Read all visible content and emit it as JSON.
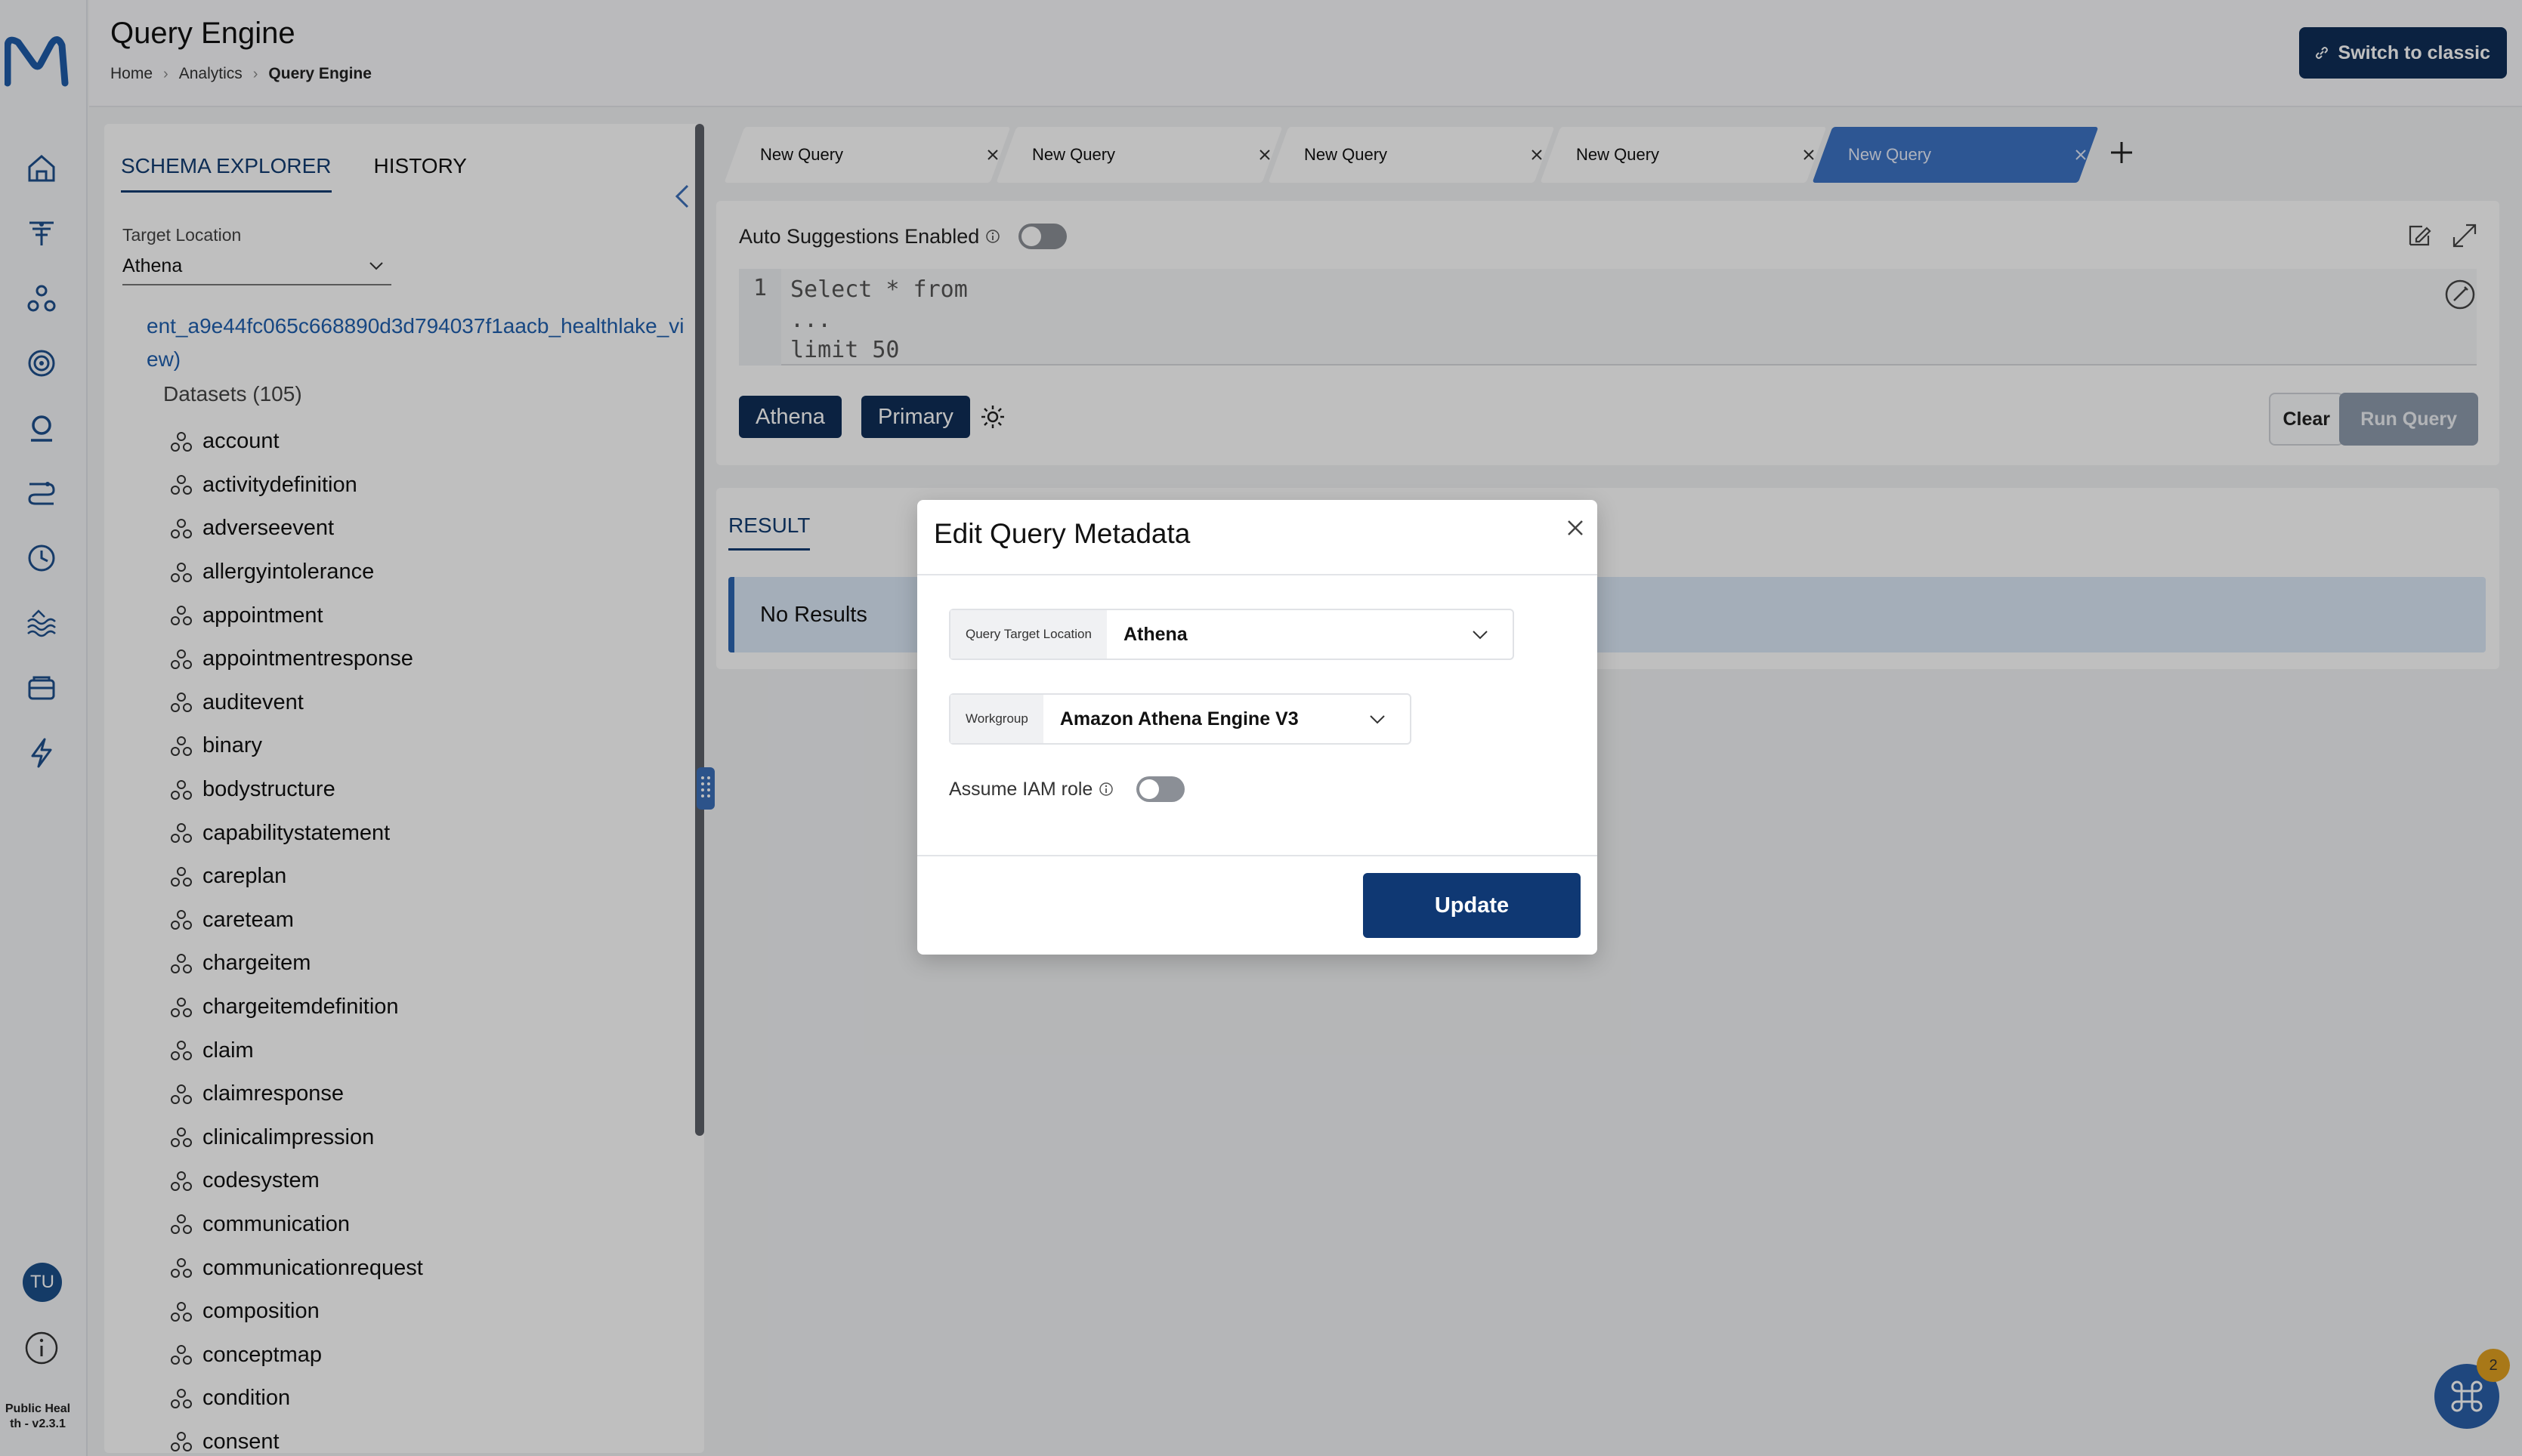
{
  "header": {
    "title": "Query Engine",
    "breadcrumb": [
      "Home",
      "Analytics",
      "Query Engine"
    ],
    "switch_label": "Switch to classic"
  },
  "sidebar": {
    "nav_icons": [
      "home-icon",
      "funnel-icon",
      "nodes-icon",
      "target-icon",
      "query-icon",
      "pipeline-icon",
      "clock-icon",
      "lake-icon",
      "database-icon",
      "lightning-icon"
    ],
    "avatar_initials": "TU",
    "version": "Public Health - v2.3.1",
    "version_lines": [
      "Public Heal",
      "th - v2.3.1"
    ]
  },
  "schema": {
    "tabs": [
      "SCHEMA EXPLORER",
      "HISTORY"
    ],
    "target_label": "Target Location",
    "target_value": "Athena",
    "database": "ent_a9e44fc065c668890d3d794037f1aacb_healthlake_view)",
    "datasets_title": "Datasets (105)",
    "datasets": [
      "account",
      "activitydefinition",
      "adverseevent",
      "allergyintolerance",
      "appointment",
      "appointmentresponse",
      "auditevent",
      "binary",
      "bodystructure",
      "capabilitystatement",
      "careplan",
      "careteam",
      "chargeitem",
      "chargeitemdefinition",
      "claim",
      "claimresponse",
      "clinicalimpression",
      "codesystem",
      "communication",
      "communicationrequest",
      "composition",
      "conceptmap",
      "condition",
      "consent"
    ]
  },
  "query_tabs": [
    {
      "label": "New Query",
      "active": false
    },
    {
      "label": "New Query",
      "active": false
    },
    {
      "label": "New Query",
      "active": false
    },
    {
      "label": "New Query",
      "active": false
    },
    {
      "label": "New Query",
      "active": true
    }
  ],
  "editor": {
    "auto_suggestions_label": "Auto Suggestions Enabled",
    "auto_suggestions_on": false,
    "line_number": "1",
    "code_lines": [
      "Select * from",
      "...",
      "limit 50"
    ],
    "chips": [
      "Athena",
      "Primary"
    ],
    "clear_label": "Clear",
    "run_label": "Run Query"
  },
  "result": {
    "tab_label": "RESULT",
    "message": "No Results"
  },
  "modal": {
    "title": "Edit Query Metadata",
    "target_label": "Query Target Location",
    "target_value": "Athena",
    "workgroup_label": "Workgroup",
    "workgroup_value": "Amazon Athena Engine V3",
    "assume_label": "Assume IAM role",
    "assume_on": false,
    "update_label": "Update"
  },
  "fab": {
    "badge": "2"
  },
  "colors": {
    "primary": "#0f2e57",
    "accent": "#3c73c4",
    "link": "#1f5fae"
  }
}
